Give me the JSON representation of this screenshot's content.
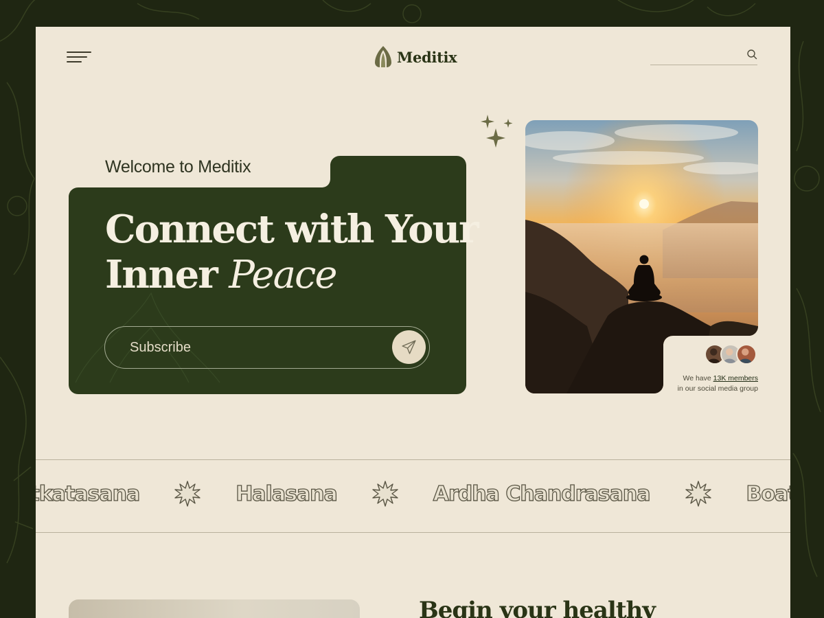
{
  "brand": {
    "name": "Meditix"
  },
  "header": {
    "search_placeholder": ""
  },
  "hero": {
    "welcome": "Welcome to Meditix",
    "headline_line1": "Connect with Your",
    "headline_line2_plain": "Inner ",
    "headline_line2_italic": "Peace",
    "subscribe_placeholder": "Subscribe"
  },
  "community": {
    "prefix": "We have ",
    "count": "13K members",
    "suffix": "in our social media group",
    "avatar_count": 3
  },
  "marquee": {
    "items": [
      "Utkatasana",
      "Halasana",
      "Ardha Chandrasana",
      "Boat Pose"
    ]
  },
  "section2": {
    "title": "Begin your healthy"
  },
  "colors": {
    "frame_bg": "#1f2612",
    "page_bg": "#efe7d7",
    "hero_green": "#2c3b1b",
    "accent_olive": "#6b6b45",
    "headline_text": "#f5efe1"
  },
  "icons": {
    "menu": "hamburger-menu-icon",
    "logo": "lotus-logo-icon",
    "search": "search-icon",
    "send": "paper-plane-icon",
    "sparkle": "sparkle-icon",
    "separator": "starburst-icon"
  }
}
